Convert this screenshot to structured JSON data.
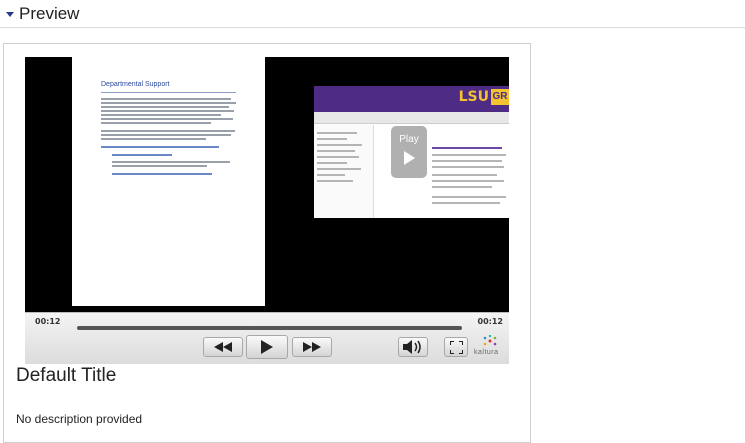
{
  "section": {
    "title": "Preview"
  },
  "player": {
    "doc_heading": "Departmental Support",
    "overlay_label": "Play",
    "time_current": "00:12",
    "time_total": "00:12",
    "brand": "kaltura",
    "screen_brand": "LSU",
    "screen_brand_tag": "GR"
  },
  "entry": {
    "title": "Default Title",
    "description": "No description provided"
  }
}
